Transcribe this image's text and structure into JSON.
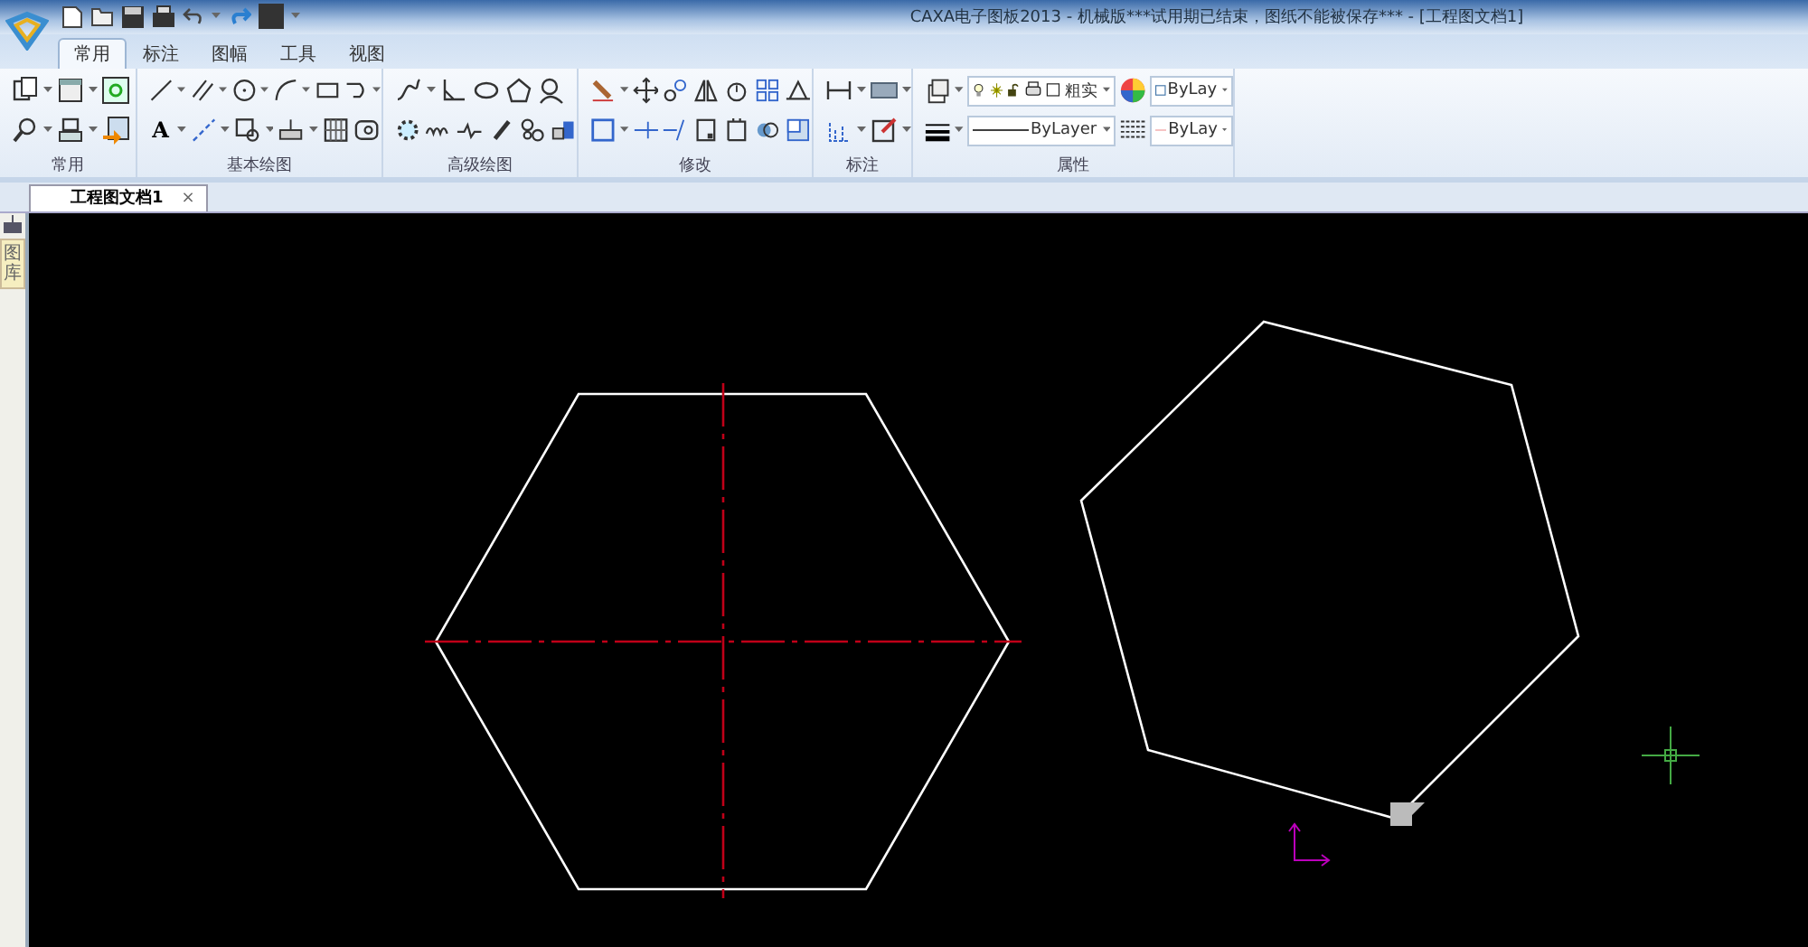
{
  "window": {
    "title": "CAXA电子图板2013 - 机械版***试用期已结束，图纸不能被保存*** - [工程图文档1]"
  },
  "ribbon_tabs": [
    {
      "label": "常用",
      "selected": true
    },
    {
      "label": "标注",
      "selected": false
    },
    {
      "label": "图幅",
      "selected": false
    },
    {
      "label": "工具",
      "selected": false
    },
    {
      "label": "视图",
      "selected": false
    }
  ],
  "ribbon_groups": [
    {
      "label": "常用"
    },
    {
      "label": "基本绘图"
    },
    {
      "label": "高级绘图"
    },
    {
      "label": "修改"
    },
    {
      "label": "标注"
    },
    {
      "label": "属性"
    }
  ],
  "text_tool": "A",
  "properties": {
    "line_style": "粗实",
    "color_setting": "ByLay",
    "line_type": "ByLayer",
    "line_color": "ByLay"
  },
  "side_panel": {
    "label": "图库"
  },
  "document_tabs": [
    {
      "label": "工程图文档1",
      "selected": true,
      "close": "×"
    }
  ]
}
